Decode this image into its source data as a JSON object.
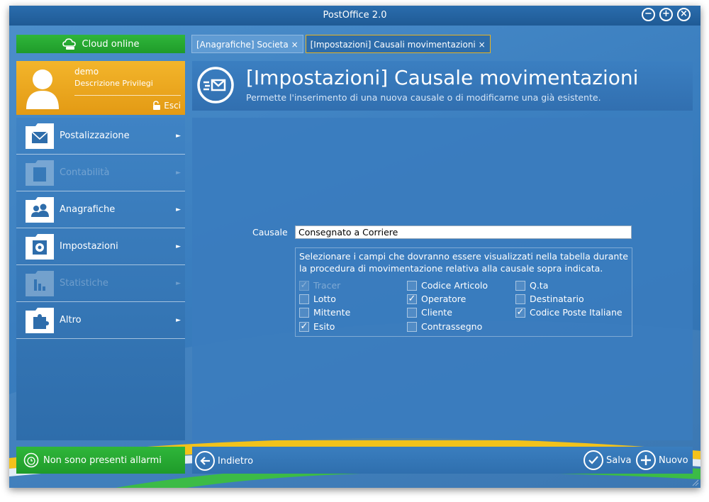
{
  "window": {
    "title": "PostOffice 2.0",
    "controls": {
      "minimize": "−",
      "maximize": "+",
      "close": "×"
    }
  },
  "status": {
    "cloud_label": "Cloud online",
    "alarm_label": "Non sono presenti allarmi"
  },
  "user": {
    "name": "demo",
    "role": "Descrizione Privilegi",
    "logout_label": "Esci"
  },
  "menu": {
    "items": [
      {
        "label": "Postalizzazione",
        "icon": "envelope-icon",
        "enabled": true
      },
      {
        "label": "Contabilità",
        "icon": "calculator-icon",
        "enabled": false
      },
      {
        "label": "Anagrafiche",
        "icon": "users-icon",
        "enabled": true
      },
      {
        "label": "Impostazioni",
        "icon": "gear-icon",
        "enabled": true
      },
      {
        "label": "Statistiche",
        "icon": "bar-chart-icon",
        "enabled": false
      },
      {
        "label": "Altro",
        "icon": "puzzle-icon",
        "enabled": true
      }
    ],
    "arrow": "►"
  },
  "tabs": [
    {
      "label": "[Anagrafiche] Societa",
      "close": "×",
      "active": false
    },
    {
      "label": "[Impostazioni] Causali movimentazioni",
      "close": "×",
      "active": true
    }
  ],
  "header": {
    "title": "[Impostazioni] Causale movimentazioni",
    "subtitle": "Permette l'inserimento di una nuova causale o di modificarne una già esistente."
  },
  "form": {
    "causale_label": "Causale",
    "causale_value": "Consegnato a Corriere",
    "fields_description": "Selezionare i campi che dovranno essere visualizzati nella tabella durante la procedura di movimentazione relativa alla causale sopra indicata.",
    "fields": [
      {
        "label": "Tracer",
        "checked": true,
        "enabled": false
      },
      {
        "label": "Codice Articolo",
        "checked": false,
        "enabled": true
      },
      {
        "label": "Q.ta",
        "checked": false,
        "enabled": true
      },
      {
        "label": "Lotto",
        "checked": false,
        "enabled": true
      },
      {
        "label": "Operatore",
        "checked": true,
        "enabled": true
      },
      {
        "label": "Destinatario",
        "checked": false,
        "enabled": true
      },
      {
        "label": "Mittente",
        "checked": false,
        "enabled": true
      },
      {
        "label": "Cliente",
        "checked": false,
        "enabled": true
      },
      {
        "label": "Codice Poste Italiane",
        "checked": true,
        "enabled": true
      },
      {
        "label": "Esito",
        "checked": true,
        "enabled": true
      },
      {
        "label": "Contrassegno",
        "checked": false,
        "enabled": true
      }
    ],
    "check_mark": "✓"
  },
  "actions": {
    "back_label": "Indietro",
    "save_label": "Salva",
    "new_label": "Nuovo"
  },
  "colors": {
    "accent_green": "#2fb63a",
    "accent_orange": "#f3b52b",
    "panel_blue": "#3a7cbe",
    "tab_active_border": "#e9b420"
  }
}
